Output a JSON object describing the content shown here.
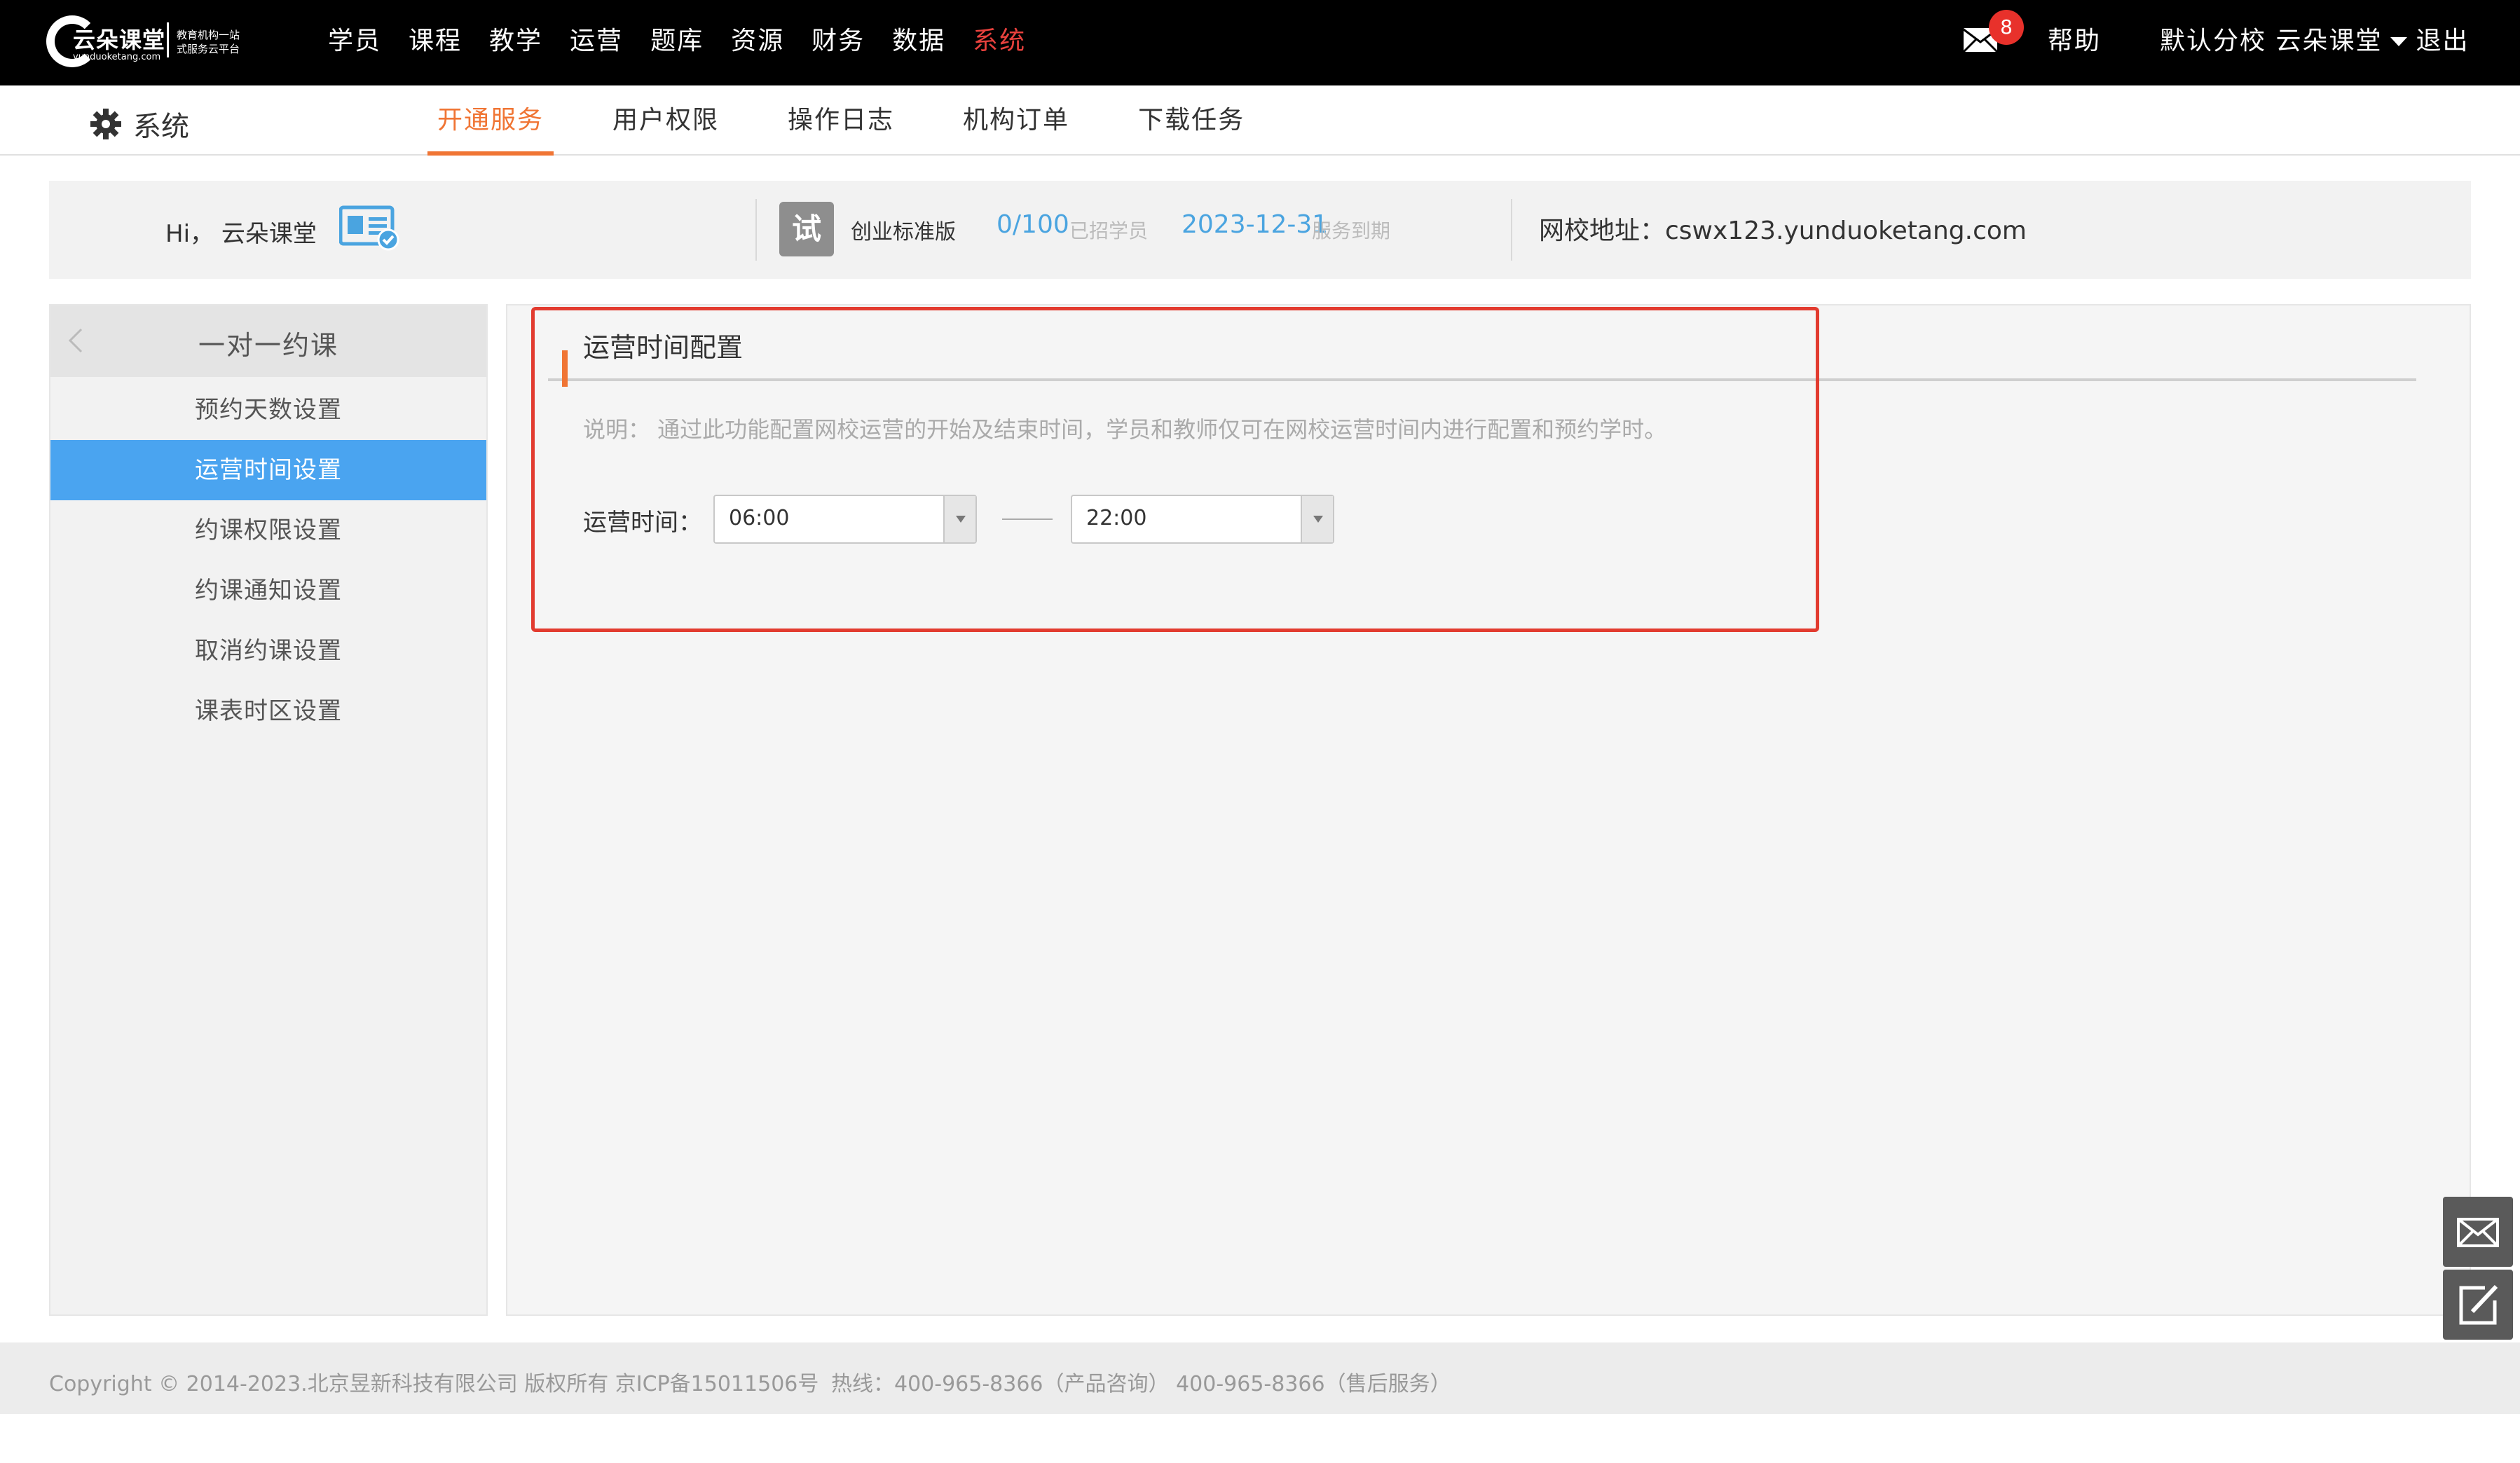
{
  "brand": {
    "name": "云朵课堂",
    "url": "yunduoketang.com",
    "slogan": "教育机构一站式服务云平台"
  },
  "main_nav": [
    {
      "label": "学员"
    },
    {
      "label": "课程"
    },
    {
      "label": "教学"
    },
    {
      "label": "运营"
    },
    {
      "label": "题库"
    },
    {
      "label": "资源"
    },
    {
      "label": "财务"
    },
    {
      "label": "数据"
    },
    {
      "label": "系统",
      "active": true
    }
  ],
  "header_right": {
    "mail_badge": "8",
    "help": "帮助",
    "branch": "默认分校 云朵课堂",
    "logout": "退出"
  },
  "sub_header": {
    "title": "系统",
    "tabs": [
      {
        "label": "开通服务",
        "active": true
      },
      {
        "label": "用户权限"
      },
      {
        "label": "操作日志"
      },
      {
        "label": "机构订单"
      },
      {
        "label": "下载任务"
      }
    ]
  },
  "info_bar": {
    "greeting": "Hi， 云朵课堂",
    "trial_icon_text": "试",
    "plan": "创业标准版",
    "students_count": "0/100",
    "students_label": "已招学员",
    "expire_date": "2023-12-31",
    "expire_label": "服务到期",
    "school_address": "网校地址：cswx123.yunduoketang.com"
  },
  "sidebar": {
    "title": "一对一约课",
    "items": [
      {
        "label": "预约天数设置"
      },
      {
        "label": "运营时间设置",
        "active": true
      },
      {
        "label": "约课权限设置"
      },
      {
        "label": "约课通知设置"
      },
      {
        "label": "取消约课设置"
      },
      {
        "label": "课表时区设置"
      }
    ]
  },
  "content": {
    "section_title": "运营时间配置",
    "description": "说明： 通过此功能配置网校运营的开始及结束时间，学员和教师仅可在网校运营时间内进行配置和预约学时。",
    "time_label": "运营时间：",
    "start_time": "06:00",
    "end_time": "22:00"
  },
  "footer": {
    "copyright": "Copyright © 2014-2023.北京昱新科技有限公司 版权所有 京ICP备15011506号",
    "hotline": "热线：400-965-8366（产品咨询） 400-965-8366（售后服务）"
  },
  "colors": {
    "accent_orange": "#f07534",
    "active_blue": "#4aa4f0",
    "nav_active_red": "#e8413d",
    "highlight_box": "#e23b2f"
  }
}
